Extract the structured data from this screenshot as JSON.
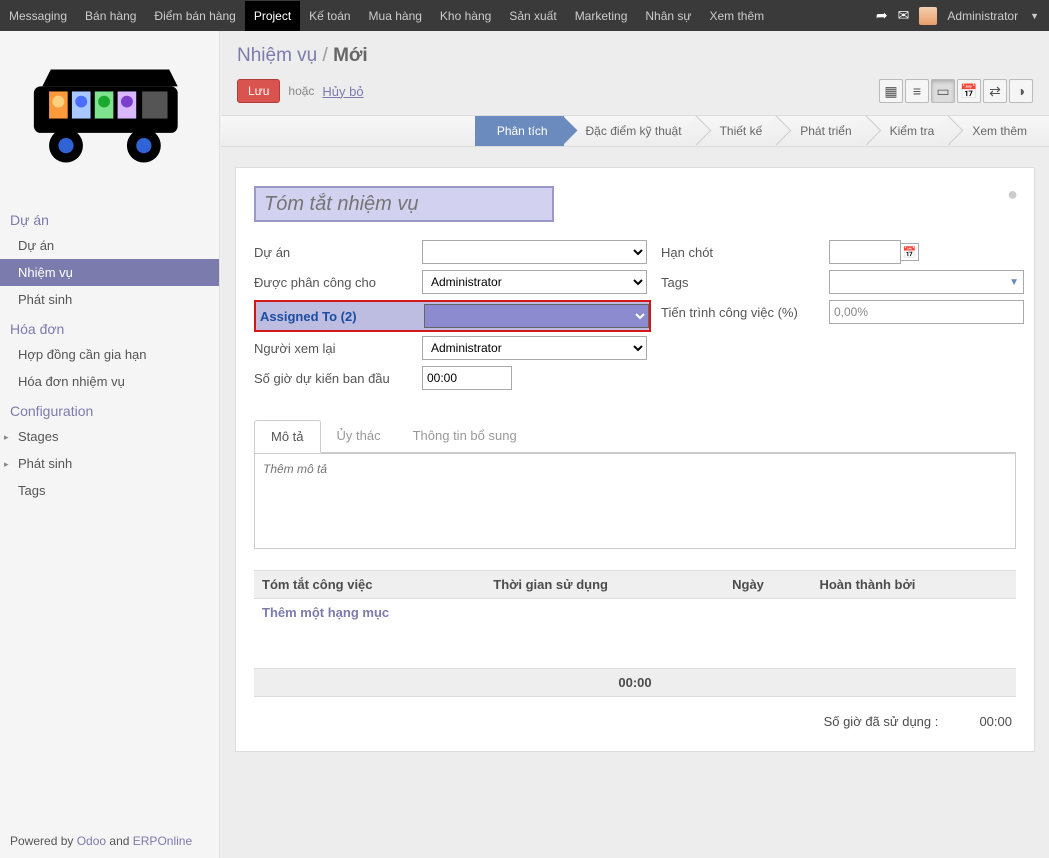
{
  "topnav": {
    "items": [
      "Messaging",
      "Bán hàng",
      "Điểm bán hàng",
      "Project",
      "Kế toán",
      "Mua hàng",
      "Kho hàng",
      "Sản xuất",
      "Marketing",
      "Nhân sự",
      "Xem thêm"
    ],
    "active_index": 3,
    "user": "Administrator"
  },
  "sidebar": {
    "groups": [
      {
        "title": "Dự án",
        "items": [
          {
            "label": "Dự án",
            "active": false,
            "caret": false
          },
          {
            "label": "Nhiệm vụ",
            "active": true,
            "caret": false
          },
          {
            "label": "Phát sinh",
            "active": false,
            "caret": false
          }
        ]
      },
      {
        "title": "Hóa đơn",
        "items": [
          {
            "label": "Hợp đồng cần gia hạn",
            "active": false,
            "caret": false
          },
          {
            "label": "Hóa đơn nhiệm vụ",
            "active": false,
            "caret": false
          }
        ]
      },
      {
        "title": "Configuration",
        "items": [
          {
            "label": "Stages",
            "active": false,
            "caret": true
          },
          {
            "label": "Phát sinh",
            "active": false,
            "caret": true
          },
          {
            "label": "Tags",
            "active": false,
            "caret": false
          }
        ]
      }
    ]
  },
  "breadcrumb": {
    "parent": "Nhiệm vụ",
    "current": "Mới"
  },
  "actions": {
    "save": "Lưu",
    "or": "hoặc",
    "discard": "Hủy bỏ"
  },
  "view_icons": [
    "kanban-icon",
    "list-icon",
    "form-icon",
    "calendar-icon",
    "gantt-icon",
    "graph-icon"
  ],
  "view_active_index": 2,
  "stages": [
    "Phân tích",
    "Đặc điểm kỹ thuật",
    "Thiết kế",
    "Phát triển",
    "Kiểm tra",
    "Xem thêm"
  ],
  "stage_active_index": 0,
  "form": {
    "summary_placeholder": "Tóm tắt nhiệm vụ",
    "left": {
      "project_label": "Dự án",
      "project_value": "",
      "assigned_label": "Được phân công cho",
      "assigned_value": "Administrator",
      "assigned2_label": "Assigned To (2)",
      "assigned2_value": "",
      "reviewer_label": "Người xem lại",
      "reviewer_value": "Administrator",
      "planned_label": "Số giờ dự kiến ban đầu",
      "planned_value": "00:00"
    },
    "right": {
      "deadline_label": "Hạn chót",
      "deadline_value": "",
      "tags_label": "Tags",
      "progress_label": "Tiến trình công việc (%)",
      "progress_value": "0,00%"
    },
    "tabs": [
      "Mô tả",
      "Ủy thác",
      "Thông tin bổ sung"
    ],
    "tab_active_index": 0,
    "desc_placeholder": "Thêm mô tả"
  },
  "work_table": {
    "headers": [
      "Tóm tắt công việc",
      "Thời gian sử dụng",
      "Ngày",
      "Hoàn thành bởi"
    ],
    "add_line": "Thêm một hạng mục",
    "total": "00:00"
  },
  "summary_footer": {
    "hours_spent_label": "Số giờ đã sử dụng :",
    "hours_spent_value": "00:00"
  },
  "footer": {
    "prefix": "Powered by ",
    "odoo": "Odoo",
    "mid": " and ",
    "erponline": "ERPOnline"
  }
}
